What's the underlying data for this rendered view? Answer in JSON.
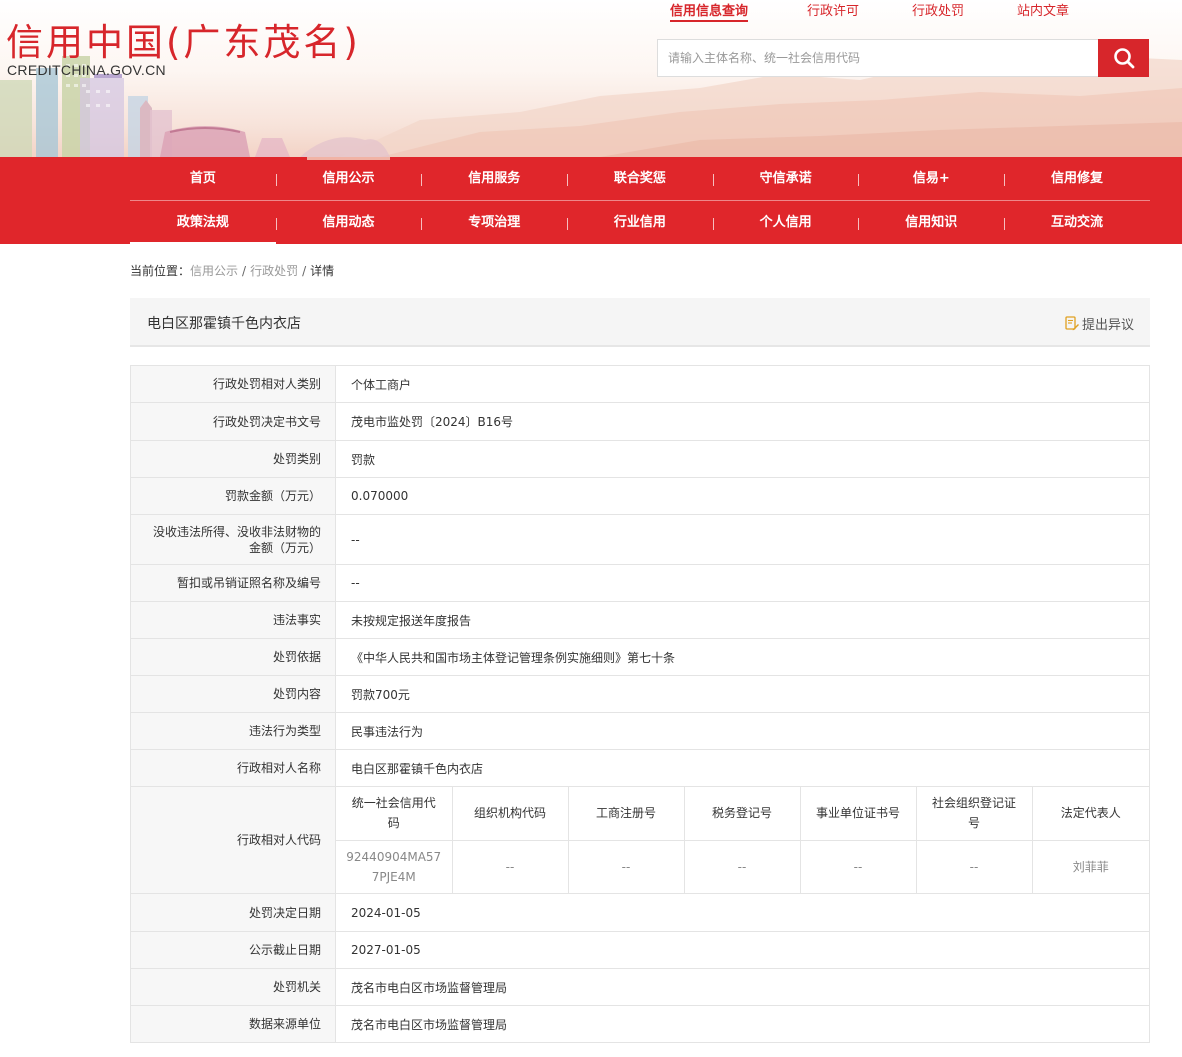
{
  "header": {
    "logo_cn": "信用中国(广东茂名)",
    "logo_en": "CREDITCHINA.GOV.CN",
    "top_links": [
      "信用信息查询",
      "行政许可",
      "行政处罚",
      "站内文章"
    ],
    "search_placeholder": "请输入主体名称、统一社会信用代码"
  },
  "nav": {
    "row1": [
      "首页",
      "信用公示",
      "信用服务",
      "联合奖惩",
      "守信承诺",
      "信易+",
      "信用修复"
    ],
    "row2": [
      "政策法规",
      "信用动态",
      "专项治理",
      "行业信用",
      "个人信用",
      "信用知识",
      "互动交流"
    ]
  },
  "breadcrumb": {
    "prefix": "当前位置：",
    "items": [
      "信用公示",
      "行政处罚"
    ],
    "current": "详情",
    "separator": "/"
  },
  "entity": {
    "name": "电白区那霍镇千色内衣店",
    "objection_label": "提出异议"
  },
  "details": {
    "party_type": {
      "label": "行政处罚相对人类别",
      "value": "个体工商户"
    },
    "doc_no": {
      "label": "行政处罚决定书文号",
      "value": "茂电市监处罚〔2024〕B16号"
    },
    "penalty_category": {
      "label": "处罚类别",
      "value": "罚款"
    },
    "fine_amount": {
      "label": "罚款金额（万元）",
      "value": "0.070000"
    },
    "confiscation_amount": {
      "label": "没收违法所得、没收非法财物的金额（万元）",
      "value": "--"
    },
    "license_info": {
      "label": "暂扣或吊销证照名称及编号",
      "value": "--"
    },
    "violation_fact": {
      "label": "违法事实",
      "value": "未按规定报送年度报告"
    },
    "penalty_basis": {
      "label": "处罚依据",
      "value": "《中华人民共和国市场主体登记管理条例实施细则》第七十条"
    },
    "penalty_content": {
      "label": "处罚内容",
      "value": "罚款700元"
    },
    "violation_type": {
      "label": "违法行为类型",
      "value": "民事违法行为"
    },
    "party_name": {
      "label": "行政相对人名称",
      "value": "电白区那霍镇千色内衣店"
    },
    "party_code": {
      "label": "行政相对人代码",
      "headers": [
        "统一社会信用代码",
        "组织机构代码",
        "工商注册号",
        "税务登记号",
        "事业单位证书号",
        "社会组织登记证号",
        "法定代表人"
      ],
      "values": [
        "92440904MA577PJE4M",
        "--",
        "--",
        "--",
        "--",
        "--",
        "刘菲菲"
      ]
    },
    "decision_date": {
      "label": "处罚决定日期",
      "value": "2024-01-05"
    },
    "publicity_end": {
      "label": "公示截止日期",
      "value": "2027-01-05"
    },
    "authority": {
      "label": "处罚机关",
      "value": "茂名市电白区市场监督管理局"
    },
    "data_source": {
      "label": "数据来源单位",
      "value": "茂名市电白区市场监督管理局"
    }
  },
  "colors": {
    "brand_red": "#d7262b",
    "nav_red": "#e0262b"
  }
}
